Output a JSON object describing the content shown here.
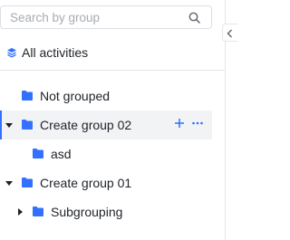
{
  "search": {
    "placeholder": "Search by group",
    "value": "",
    "icon": "search-icon"
  },
  "all_activities": {
    "label": "All activities",
    "icon": "layers-icon"
  },
  "groups": [
    {
      "label": "Not grouped",
      "icon": "folder-icon",
      "expanded": null
    },
    {
      "label": "Create group 02",
      "icon": "folder-icon",
      "expanded": true,
      "selected": true,
      "actions": [
        "plus-icon",
        "more-icon"
      ],
      "children": [
        {
          "label": "asd",
          "icon": "folder-icon"
        }
      ]
    },
    {
      "label": "Create group 01",
      "icon": "folder-icon",
      "expanded": true,
      "children": [
        {
          "label": "Subgrouping",
          "icon": "folder-icon",
          "expanded": false
        }
      ]
    }
  ],
  "colors": {
    "accent": "#3370ff",
    "folder": "#3370ff",
    "selected_bg": "#f2f3f5"
  },
  "collapse_toggle": {
    "icon": "chevron-left-icon"
  }
}
